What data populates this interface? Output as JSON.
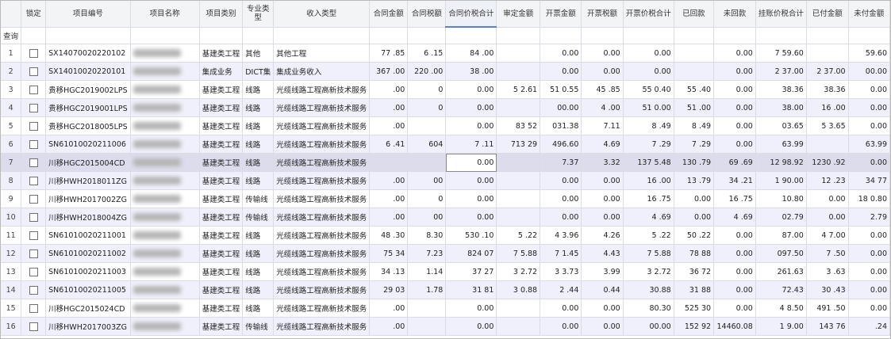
{
  "columns": [
    "锁定",
    "项目编号",
    "项目名称",
    "项目类别",
    "专业类型",
    "收入类型",
    "合同金额",
    "合同税额",
    "合同价税合计",
    "审定金额",
    "开票金额",
    "开票税额",
    "开票价税合计",
    "已回款",
    "未回款",
    "挂账价税合计",
    "已付金额",
    "未付金额"
  ],
  "query_label": "查询",
  "rows": [
    {
      "idx": "1",
      "code": "SX14070020220102",
      "name": "",
      "category": "基建类工程",
      "spec": "其他",
      "income": "其他工程",
      "contract_amount": "77 .85",
      "contract_tax": "6 .15",
      "contract_total": "84 .00",
      "audit": "",
      "inv_amount": "0.00",
      "inv_tax": "0.00",
      "inv_total": "0.00",
      "received": "",
      "unreceived": "0.00",
      "booked": "7 59.60",
      "paid": "",
      "unpaid": "59.60"
    },
    {
      "idx": "2",
      "code": "SX14010020220101",
      "name": "",
      "category": "集成业务",
      "spec": "DICT集",
      "income": "集成业务收入",
      "contract_amount": "367 .00",
      "contract_tax": "220 .00",
      "contract_total": "38 .00",
      "audit": "",
      "inv_amount": "0.00",
      "inv_tax": "0.00",
      "inv_total": "0.00",
      "received": "",
      "unreceived": "0.00",
      "booked": "2 37.00",
      "paid": "2 37.00",
      "unpaid": "00.00"
    },
    {
      "idx": "3",
      "code": "贵移HGC2019002LPS",
      "name": "",
      "category": "基建类工程",
      "spec": "线路",
      "income": "光缆线路工程高新技术服务",
      "contract_amount": ".00",
      "contract_tax": "0",
      "contract_total": "0.00",
      "audit": "5 2.61",
      "inv_amount": "51 0.55",
      "inv_tax": "45 .85",
      "inv_total": "55 0.40",
      "received": "55 .40",
      "unreceived": "0.00",
      "booked": "38.36",
      "paid": "38.36",
      "unpaid": "0.00"
    },
    {
      "idx": "4",
      "code": "贵移HGC2019001LPS",
      "name": "",
      "category": "基建类工程",
      "spec": "线路",
      "income": "光缆线路工程高新技术服务",
      "contract_amount": ".00",
      "contract_tax": "0",
      "contract_total": "0.00",
      "audit": "",
      "inv_amount": "00.00",
      "inv_tax": "4 .00",
      "inv_total": "51 0.00",
      "received": "51 .00",
      "unreceived": "0.00",
      "booked": "38.00",
      "paid": "16 .00",
      "unpaid": "0.00"
    },
    {
      "idx": "5",
      "code": "贵移HGC2018005LPS",
      "name": "",
      "category": "基建类工程",
      "spec": "线路",
      "income": "光缆线路工程高新技术服务",
      "contract_amount": ".00",
      "contract_tax": "",
      "contract_total": "0.00",
      "audit": "83 52",
      "inv_amount": "031.38",
      "inv_tax": "7.11",
      "inv_total": "8 .49",
      "received": "8 .49",
      "unreceived": "0.00",
      "booked": "03.65",
      "paid": "5 3.65",
      "unpaid": "0.00"
    },
    {
      "idx": "6",
      "code": "SN61010020211006",
      "name": "",
      "category": "基建类工程",
      "spec": "线路",
      "income": "光缆线路工程高新技术服务",
      "contract_amount": "6 .41",
      "contract_tax": "604",
      "contract_total": "7 .11",
      "audit": "713 29",
      "inv_amount": "496.60",
      "inv_tax": "4.69",
      "inv_total": "7 .29",
      "received": "7 .29",
      "unreceived": "0.00",
      "booked": "63.99",
      "paid": "",
      "unpaid": "63.99"
    },
    {
      "idx": "7",
      "code": "川移HGC2015004CD",
      "name": "",
      "category": "基建类工程",
      "spec": "线路",
      "income": "光缆线路工程高新技术服务",
      "contract_amount": "",
      "contract_tax": "",
      "contract_total": "0.00",
      "audit": "",
      "inv_amount": "7.37",
      "inv_tax": "3.32",
      "inv_total": "137 5.48",
      "received": "130 .79",
      "unreceived": "69 .69",
      "booked": "12 98.92",
      "paid": "1230 .92",
      "unpaid": "0.00"
    },
    {
      "idx": "8",
      "code": "川移HWH2018011ZG",
      "name": "",
      "category": "基建类工程",
      "spec": "线路",
      "income": "光缆线路工程高新技术服务",
      "contract_amount": ".00",
      "contract_tax": "00",
      "contract_total": "0.00",
      "audit": "",
      "inv_amount": "0.00",
      "inv_tax": "0.00",
      "inv_total": "16 .00",
      "received": "13 .79",
      "unreceived": "34 .21",
      "booked": "1 90.00",
      "paid": "12 .23",
      "unpaid": "34 77"
    },
    {
      "idx": "9",
      "code": "川移HWH2017002ZG",
      "name": "",
      "category": "基建类工程",
      "spec": "传输线",
      "income": "光缆线路工程高新技术服务",
      "contract_amount": ".00",
      "contract_tax": "0",
      "contract_total": "0.00",
      "audit": "",
      "inv_amount": "0.00",
      "inv_tax": "0.00",
      "inv_total": "16 .75",
      "received": "0.00",
      "unreceived": "16 .75",
      "booked": "10.80",
      "paid": "0.00",
      "unpaid": "18 0.80"
    },
    {
      "idx": "10",
      "code": "川移HWH2018004ZG",
      "name": "",
      "category": "基建类工程",
      "spec": "传输线",
      "income": "光缆线路工程高新技术服务",
      "contract_amount": ".00",
      "contract_tax": "00",
      "contract_total": "0.00",
      "audit": "",
      "inv_amount": "0.00",
      "inv_tax": "0.00",
      "inv_total": "4 .69",
      "received": "0.00",
      "unreceived": "4 .69",
      "booked": "02.79",
      "paid": "0.00",
      "unpaid": "2.79"
    },
    {
      "idx": "11",
      "code": "SN61010020211001",
      "name": "",
      "category": "基建类工程",
      "spec": "线路",
      "income": "光缆线路工程高新技术服务",
      "contract_amount": "48 .30",
      "contract_tax": "8.30",
      "contract_total": "530 .10",
      "audit": "5 .22",
      "inv_amount": "4 3.96",
      "inv_tax": "4.26",
      "inv_total": "5 .22",
      "received": "50 .22",
      "unreceived": "0.00",
      "booked": "87.00",
      "paid": "4 7.00",
      "unpaid": "0.00"
    },
    {
      "idx": "12",
      "code": "SN61010020211002",
      "name": "",
      "category": "基建类工程",
      "spec": "线路",
      "income": "光缆线路工程高新技术服务",
      "contract_amount": "75 34",
      "contract_tax": "7.23",
      "contract_total": "824 07",
      "audit": "7 5.88",
      "inv_amount": "7 1.45",
      "inv_tax": "4.43",
      "inv_total": "7 5.88",
      "received": "78 88",
      "unreceived": "0.00",
      "booked": "097.50",
      "paid": "7 .50",
      "unpaid": "0.00"
    },
    {
      "idx": "13",
      "code": "SN61010020211003",
      "name": "",
      "category": "基建类工程",
      "spec": "线路",
      "income": "光缆线路工程高新技术服务",
      "contract_amount": "34 .13",
      "contract_tax": "1.14",
      "contract_total": "37 27",
      "audit": "3 2.72",
      "inv_amount": "3 3.73",
      "inv_tax": "3.99",
      "inv_total": "3 2.72",
      "received": "36 72",
      "unreceived": "0.00",
      "booked": "261.63",
      "paid": "3 .63",
      "unpaid": "0.00"
    },
    {
      "idx": "14",
      "code": "SN61010020211005",
      "name": "",
      "category": "基建类工程",
      "spec": "线路",
      "income": "光缆线路工程高新技术服务",
      "contract_amount": "29 03",
      "contract_tax": "1.78",
      "contract_total": "31 81",
      "audit": "3 0.88",
      "inv_amount": "2 .44",
      "inv_tax": "0.44",
      "inv_total": "30.88",
      "received": "31 88",
      "unreceived": "0.00",
      "booked": "72.43",
      "paid": "30 .43",
      "unpaid": "0.00"
    },
    {
      "idx": "15",
      "code": "川移HGC2015024CD",
      "name": "",
      "category": "基建类工程",
      "spec": "线路",
      "income": "光缆线路工程高新技术服务",
      "contract_amount": ".00",
      "contract_tax": "",
      "contract_total": "0.00",
      "audit": "",
      "inv_amount": "0.00",
      "inv_tax": "0.00",
      "inv_total": "80.30",
      "received": "525 30",
      "unreceived": "0.00",
      "booked": "4 8.50",
      "paid": "491 .50",
      "unpaid": "0.00"
    },
    {
      "idx": "16",
      "code": "川移HWH2017003ZG",
      "name": "",
      "category": "基建类工程",
      "spec": "传输线",
      "income": "光缆线路工程高新技术服务",
      "contract_amount": ".00",
      "contract_tax": "",
      "contract_total": "0.00",
      "audit": "",
      "inv_amount": "0.00",
      "inv_tax": "0.00",
      "inv_total": "00.00",
      "received": "152 92",
      "unreceived": "14460.08",
      "booked": "1 9.00",
      "paid": "143 76",
      "unpaid": ".24"
    }
  ]
}
